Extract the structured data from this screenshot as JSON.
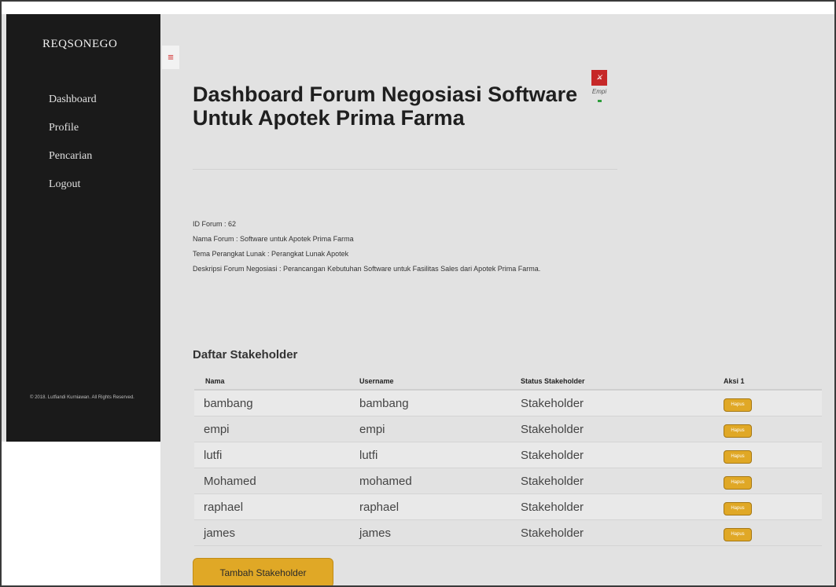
{
  "sidebar": {
    "brand": "REQSONEGO",
    "nav": [
      "Dashboard",
      "Profile",
      "Pencarian",
      "Logout"
    ],
    "copyright": "© 2018. Lutfiandi Kurniawan. All Rights Reserved."
  },
  "toggle_icon": "hamburger-menu-icon",
  "page": {
    "title": "Dashboard Forum Negosiasi Software Untuk Apotek Prima Farma"
  },
  "user": {
    "name": "Empi",
    "status_color": "#2e9d3c"
  },
  "forum": {
    "id": "ID Forum : 62",
    "name": "Nama Forum : Software untuk Apotek Prima Farma",
    "theme": "Tema Perangkat Lunak : Perangkat Lunak Apotek",
    "description": "Deskripsi Forum Negosiasi : Perancangan Kebutuhan Software untuk Fasilitas Sales dari Apotek Prima Farma."
  },
  "stakeholders": {
    "title": "Daftar Stakeholder",
    "columns": [
      "Nama",
      "Username",
      "Status Stakeholder",
      "Aksi 1"
    ],
    "rows": [
      {
        "nama": "bambang",
        "username": "bambang",
        "status": "Stakeholder",
        "action": "Hapus"
      },
      {
        "nama": "empi",
        "username": "empi",
        "status": "Stakeholder",
        "action": "Hapus"
      },
      {
        "nama": "lutfi",
        "username": "lutfi",
        "status": "Stakeholder",
        "action": "Hapus"
      },
      {
        "nama": "Mohamed",
        "username": "mohamed",
        "status": "Stakeholder",
        "action": "Hapus"
      },
      {
        "nama": "raphael",
        "username": "raphael",
        "status": "Stakeholder",
        "action": "Hapus"
      },
      {
        "nama": "james",
        "username": "james",
        "status": "Stakeholder",
        "action": "Hapus"
      }
    ],
    "add_label": "Tambah Stakeholder"
  },
  "colors": {
    "sidebar": "#1a1a1a",
    "accent": "#e0a826",
    "danger": "#d32f2f"
  }
}
